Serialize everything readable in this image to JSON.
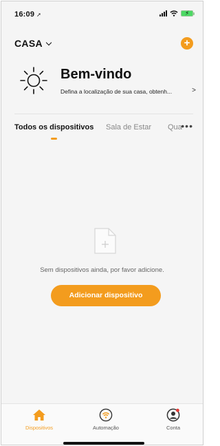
{
  "status_bar": {
    "time": "16:09"
  },
  "header": {
    "home_name": "CASA",
    "add_button_label": "+"
  },
  "welcome": {
    "title": "Bem-vindo",
    "subtitle": "Defina a localização de sua casa, obtenh...",
    "arrow": ">"
  },
  "tabs": [
    {
      "label": "Todos os dispositivos",
      "active": true
    },
    {
      "label": "Sala de Estar",
      "active": false
    },
    {
      "label": "Qua",
      "active": false
    }
  ],
  "more_label": "•••",
  "empty_state": {
    "message": "Sem dispositivos ainda, por favor adicione.",
    "button_label": "Adicionar dispositivo"
  },
  "bottom_nav": [
    {
      "label": "Dispositivos",
      "icon": "home-icon",
      "active": true
    },
    {
      "label": "Automação",
      "icon": "automation-icon",
      "active": false
    },
    {
      "label": "Conta",
      "icon": "account-icon",
      "active": false
    }
  ],
  "colors": {
    "accent": "#f39c1e",
    "background": "#f5f5f5",
    "battery": "#4cd964",
    "notification_dot": "#e53935"
  }
}
